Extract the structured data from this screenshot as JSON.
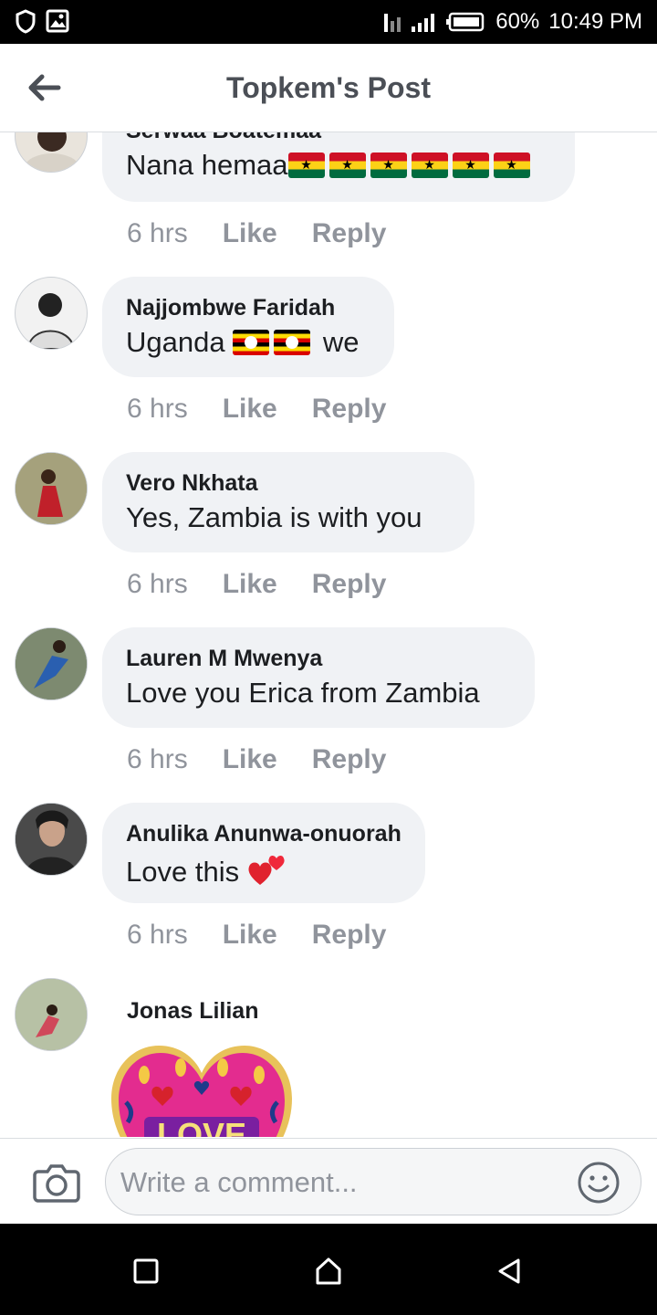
{
  "status_bar": {
    "battery": "60%",
    "time": "10:49 PM"
  },
  "header": {
    "title": "Topkem's Post"
  },
  "comments": [
    {
      "name": "Serwaa Boatemaa",
      "text": "Nana hemaa",
      "time": "6 hrs",
      "like": "Like",
      "reply": "Reply"
    },
    {
      "name": "Najjombwe Faridah",
      "text_before": "Uganda",
      "text_after": "we",
      "time": "6 hrs",
      "like": "Like",
      "reply": "Reply"
    },
    {
      "name": "Vero Nkhata",
      "text": "Yes, Zambia is with you",
      "time": "6 hrs",
      "like": "Like",
      "reply": "Reply"
    },
    {
      "name": "Lauren M Mwenya",
      "text": "Love you Erica from Zambia",
      "time": "6 hrs",
      "like": "Like",
      "reply": "Reply"
    },
    {
      "name": "Anulika Anunwa-onuorah",
      "text": "Love this",
      "time": "6 hrs",
      "like": "Like",
      "reply": "Reply"
    },
    {
      "name": "Jonas Lilian",
      "sticker_text": "LOVE"
    }
  ],
  "composer": {
    "placeholder": "Write a comment..."
  },
  "icons": {
    "back": "arrow-left-icon",
    "camera": "camera-icon",
    "emoji": "smiley-icon",
    "recents": "square-icon",
    "home": "home-icon",
    "back_nav": "triangle-back-icon"
  }
}
